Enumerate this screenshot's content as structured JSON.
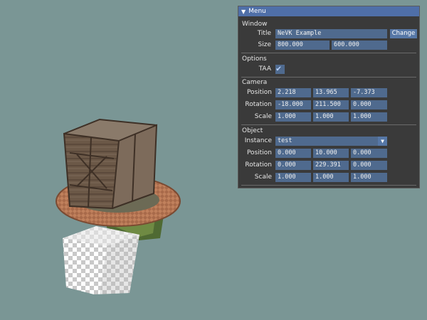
{
  "menu": {
    "title": "Menu",
    "window": {
      "section": "Window",
      "title_label": "Title",
      "title_value": "NeVK Example",
      "change_button": "Change",
      "size_label": "Size",
      "size_w": "800.000",
      "size_h": "600.000"
    },
    "options": {
      "section": "Options",
      "taa_label": "TAA",
      "taa_checked": true
    },
    "camera": {
      "section": "Camera",
      "position_label": "Position",
      "position": [
        "2.218",
        "13.965",
        "-7.373"
      ],
      "rotation_label": "Rotation",
      "rotation": [
        "-18.000",
        "211.500",
        "0.000"
      ],
      "scale_label": "Scale",
      "scale": [
        "1.000",
        "1.000",
        "1.000"
      ]
    },
    "object": {
      "section": "Object",
      "instance_label": "Instance",
      "instance_value": "test",
      "position_label": "Position",
      "position": [
        "0.000",
        "10.000",
        "0.000"
      ],
      "rotation_label": "Rotation",
      "rotation": [
        "0.000",
        "229.391",
        "0.000"
      ],
      "scale_label": "Scale",
      "scale": [
        "1.000",
        "1.000",
        "1.000"
      ]
    }
  },
  "icons": {
    "collapse": "triangle-down-icon",
    "checkbox": "checkmark-icon",
    "combo": "dropdown-arrow-icon"
  },
  "colors": {
    "background": "#7a9695",
    "panel": "#3a3a3a",
    "title_bar": "#4f6fa8",
    "field": "#4f6a8e"
  }
}
